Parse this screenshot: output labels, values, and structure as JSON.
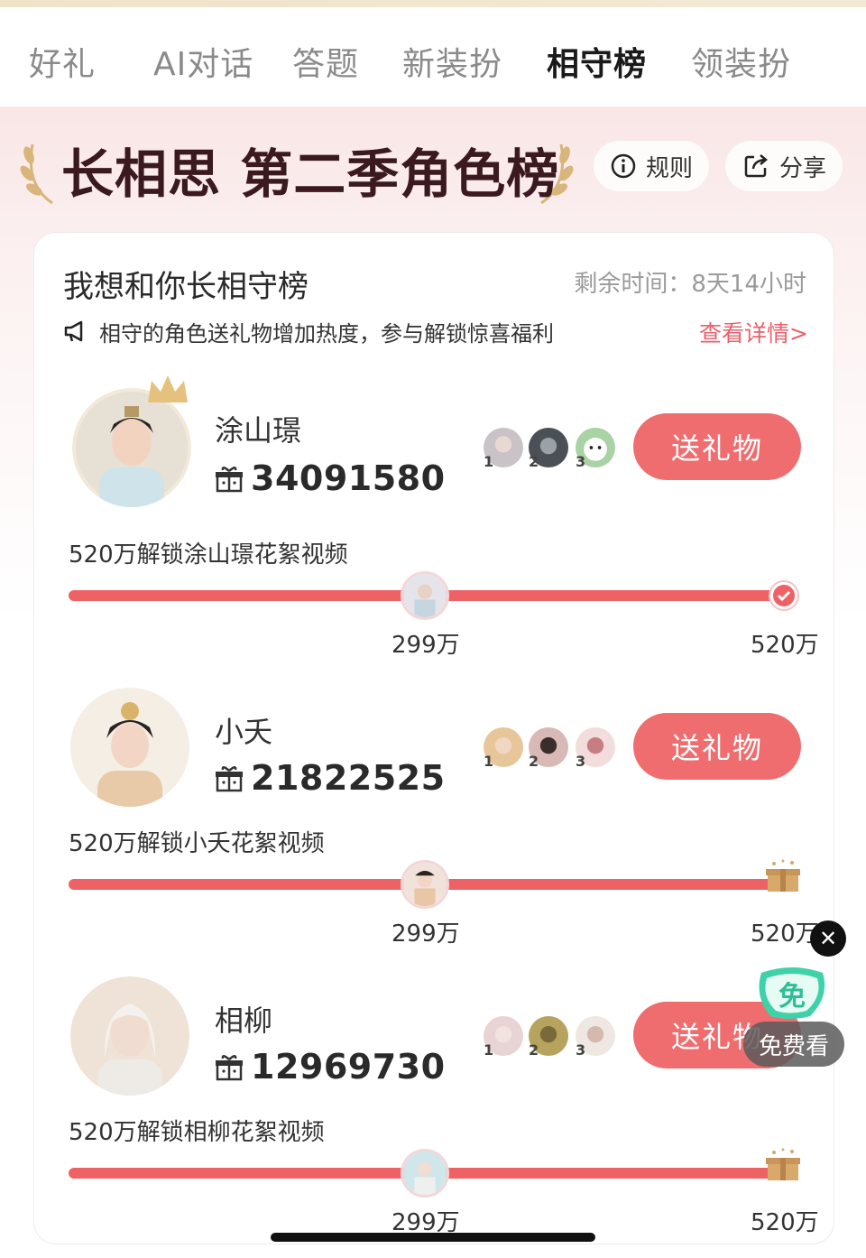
{
  "tabs": [
    {
      "label": "好礼"
    },
    {
      "label": "AI对话"
    },
    {
      "label": "答题"
    },
    {
      "label": "新装扮"
    },
    {
      "label": "相守榜"
    },
    {
      "label": "领装扮"
    }
  ],
  "header": {
    "title": "长相思 第二季角色榜",
    "rules_label": "规则",
    "share_label": "分享"
  },
  "board": {
    "title": "我想和你长相守榜",
    "remaining": "剩余时间：8天14小时",
    "notice": "相守的角色送礼物增加热度，参与解锁惊喜福利",
    "details_link": "查看详情>"
  },
  "colors": {
    "accent": "#ef6d6f",
    "track": "#ee6266",
    "title": "#3a1a1f",
    "link": "#e8616b"
  },
  "progress_start_label": "299万",
  "progress_end_label": "520万",
  "characters": [
    {
      "name": "涂山璟",
      "score": "34091580",
      "gift_button": "送礼物",
      "unlock_text": "520万解锁涂山璟花絮视频",
      "progress_mark": "299万",
      "progress_goal": "520万",
      "goal_reached": true,
      "fan_ranks": [
        "1",
        "2",
        "3"
      ]
    },
    {
      "name": "小夭",
      "score": "21822525",
      "gift_button": "送礼物",
      "unlock_text": "520万解锁小夭花絮视频",
      "progress_mark": "299万",
      "progress_goal": "520万",
      "goal_reached": false,
      "fan_ranks": [
        "1",
        "2",
        "3"
      ]
    },
    {
      "name": "相柳",
      "score": "12969730",
      "gift_button": "送礼物",
      "unlock_text": "520万解锁相柳花絮视频",
      "progress_mark": "299万",
      "progress_goal": "520万",
      "goal_reached": false,
      "fan_ranks": [
        "1",
        "2",
        "3"
      ]
    }
  ],
  "floating": {
    "label": "免费看",
    "badge_char": "免",
    "close_symbol": "✕"
  }
}
